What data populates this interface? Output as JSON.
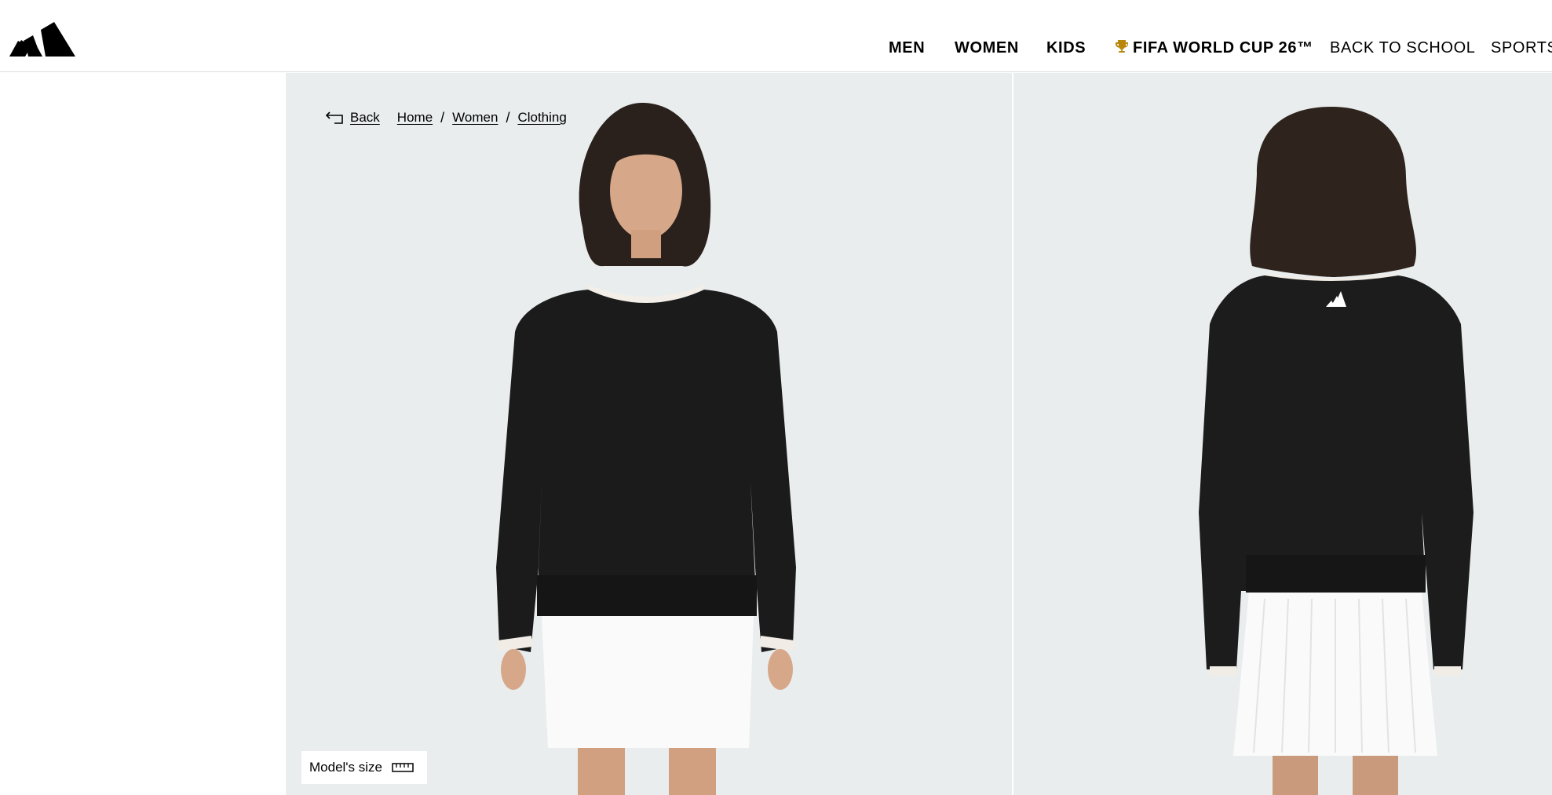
{
  "brand": {
    "logo_icon": "adidas-logo-icon"
  },
  "nav": {
    "items": [
      {
        "label": "MEN",
        "weight": "bold"
      },
      {
        "label": "WOMEN",
        "weight": "bold"
      },
      {
        "label": "KIDS",
        "weight": "bold"
      },
      {
        "label": "FIFA WORLD CUP 26™",
        "weight": "bold",
        "icon": "trophy-icon"
      },
      {
        "label": "BACK TO SCHOOL",
        "weight": "light"
      },
      {
        "label": "SPORTS",
        "weight": "light"
      }
    ]
  },
  "breadcrumb": {
    "back_label": "Back",
    "items": [
      "Home",
      "Women",
      "Clothing"
    ],
    "separator": "/"
  },
  "gallery": {
    "images": [
      {
        "name": "product-image-front",
        "view": "front"
      },
      {
        "name": "product-image-back",
        "view": "back"
      }
    ],
    "background": "#eaedee"
  },
  "model_size": {
    "label": "Model's size",
    "icon": "ruler-icon"
  },
  "colors": {
    "accent": "#000000",
    "panel_bg": "#eaedee"
  }
}
